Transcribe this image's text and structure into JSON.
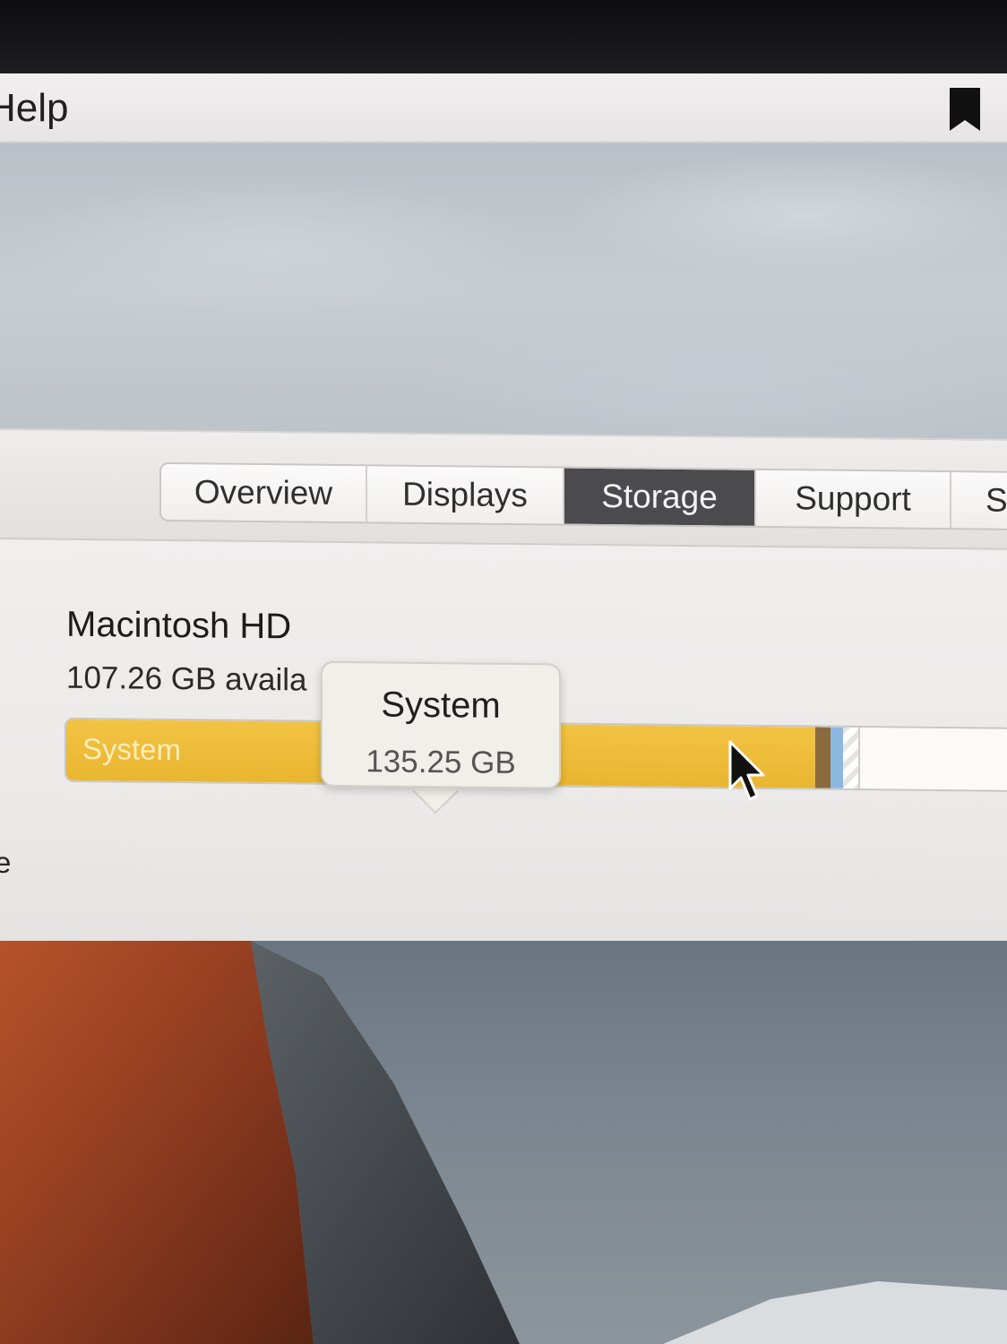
{
  "menubar": {
    "help_label": "Help"
  },
  "tabs": [
    {
      "label": "Overview",
      "active": false
    },
    {
      "label": "Displays",
      "active": false
    },
    {
      "label": "Storage",
      "active": true
    },
    {
      "label": "Support",
      "active": false
    },
    {
      "label": "S",
      "active": false
    }
  ],
  "storage": {
    "disk_name": "Macintosh HD",
    "availability": "107.26 GB availa",
    "availability_tail": "GB",
    "segments": [
      {
        "label": "System",
        "size": "135.25 GB",
        "fraction": 0.792,
        "color": "#efbe3c"
      },
      {
        "label": "",
        "fraction": 0.016,
        "color": "#8a6a3e"
      },
      {
        "label": "",
        "fraction": 0.013,
        "color": "#8ab8df"
      },
      {
        "label": "",
        "fraction": 0.018,
        "color": "purgeable"
      }
    ]
  },
  "tooltip": {
    "title": "System",
    "value": "135.25 GB"
  },
  "left_edge_text": "e",
  "icons": {
    "bookmark": "bookmark-icon",
    "cursor": "arrow-cursor-icon"
  }
}
